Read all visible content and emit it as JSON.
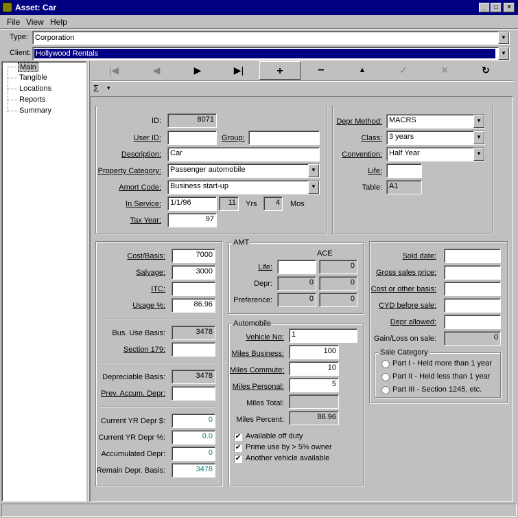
{
  "window": {
    "title": "Asset:  Car",
    "min": "_",
    "max": "□",
    "close": "×"
  },
  "menu": [
    "File",
    "View",
    "Help"
  ],
  "type": {
    "label": "Type:",
    "value": "Corporation"
  },
  "client": {
    "label": "Client:",
    "value": "Hollywood Rentals"
  },
  "tree": [
    "Main",
    "Tangible",
    "Locations",
    "Reports",
    "Summary"
  ],
  "nav": {
    "first": "|◀",
    "prev": "◀",
    "next": "▶",
    "last": "▶|",
    "add": "+",
    "remove": "−",
    "up": "▲",
    "check": "✓",
    "cancel": "✕",
    "refresh": "↻",
    "sigma": "Σ",
    "sigma_arrow": "▾"
  },
  "main": {
    "id_label": "ID:",
    "id": "8071",
    "user_id_label": "User ID:",
    "user_id": "",
    "group_label": "Group:",
    "group": "",
    "description_label": "Description:",
    "description": "Car",
    "property_category_label": "Property Category:",
    "property_category": "Passenger automobile",
    "amort_code_label": "Amort Code:",
    "amort_code": "Business start-up",
    "in_service_label": "In Service:",
    "in_service": "1/1/96",
    "yrs": "11",
    "yrs_label": "Yrs",
    "mos": "4",
    "mos_label": "Mos",
    "tax_year_label": "Tax Year:",
    "tax_year": "97"
  },
  "depr": {
    "method_label": "Depr Method:",
    "method": "MACRS",
    "class_label": "Class:",
    "class": "3 years",
    "convention_label": "Convention:",
    "convention": "Half Year",
    "life_label": "Life:",
    "life": "",
    "table_label": "Table:",
    "table": "A1"
  },
  "cost": {
    "cost_basis_label": "Cost/Basis:",
    "cost_basis": "7000",
    "salvage_label": "Salvage:",
    "salvage": "3000",
    "itc_label": "ITC:",
    "itc": "",
    "usage_label": "Usage %:",
    "usage": "86.96",
    "bus_use_basis_label": "Bus. Use Basis:",
    "bus_use_basis": "3478",
    "section179_label": "Section 179:",
    "section179": "",
    "depreciable_basis_label": "Depreciable Basis:",
    "depreciable_basis": "3478",
    "prev_accum_label": "Prev. Accum. Depr:",
    "prev_accum": "",
    "cur_yr_depr_label": "Current YR Depr $:",
    "cur_yr_depr": "0",
    "cur_yr_pct_label": "Current YR Depr %:",
    "cur_yr_pct": "0.0",
    "accum_label": "Accumulated Depr:",
    "accum": "0",
    "remain_label": "Remain Depr. Basis:",
    "remain": "3478"
  },
  "amt": {
    "title": "AMT",
    "ace_label": "ACE",
    "life_label": "Life:",
    "life": "",
    "life_ace": "0",
    "depr_label": "Depr:",
    "depr": "0",
    "depr_ace": "0",
    "pref_label": "Preference:",
    "pref": "0",
    "pref_ace": "0"
  },
  "auto": {
    "title": "Automobile",
    "vehicle_no_label": "Vehicle No:",
    "vehicle_no": "1",
    "miles_business_label": "Miles Business:",
    "miles_business": "100",
    "miles_commute_label": "Miles Commute:",
    "miles_commute": "10",
    "miles_personal_label": "Miles Personal:",
    "miles_personal": "5",
    "miles_total_label": "Miles Total:",
    "miles_total": "",
    "miles_percent_label": "Miles Percent:",
    "miles_percent": "86.96",
    "checks": [
      {
        "label": "Available off duty",
        "checked": true
      },
      {
        "label": "Prime use by > 5% owner",
        "checked": true
      },
      {
        "label": "Another vehicle available",
        "checked": true
      }
    ]
  },
  "sale": {
    "sold_date_label": "Sold date:",
    "sold_date": "",
    "gross_label": "Gross sales price:",
    "gross": "",
    "cost_other_label": "Cost or other basis:",
    "cost_other": "",
    "cyd_label": "CYD before sale:",
    "cyd": "",
    "depr_allowed_label": "Depr allowed:",
    "depr_allowed": "",
    "gain_loss_label": "Gain/Loss on sale:",
    "gain_loss": "0",
    "category_title": "Sale Category",
    "categories": [
      "Part I - Held more than 1 year",
      "Part II - Held less than 1 year",
      "Part III - Section 1245, etc."
    ]
  }
}
